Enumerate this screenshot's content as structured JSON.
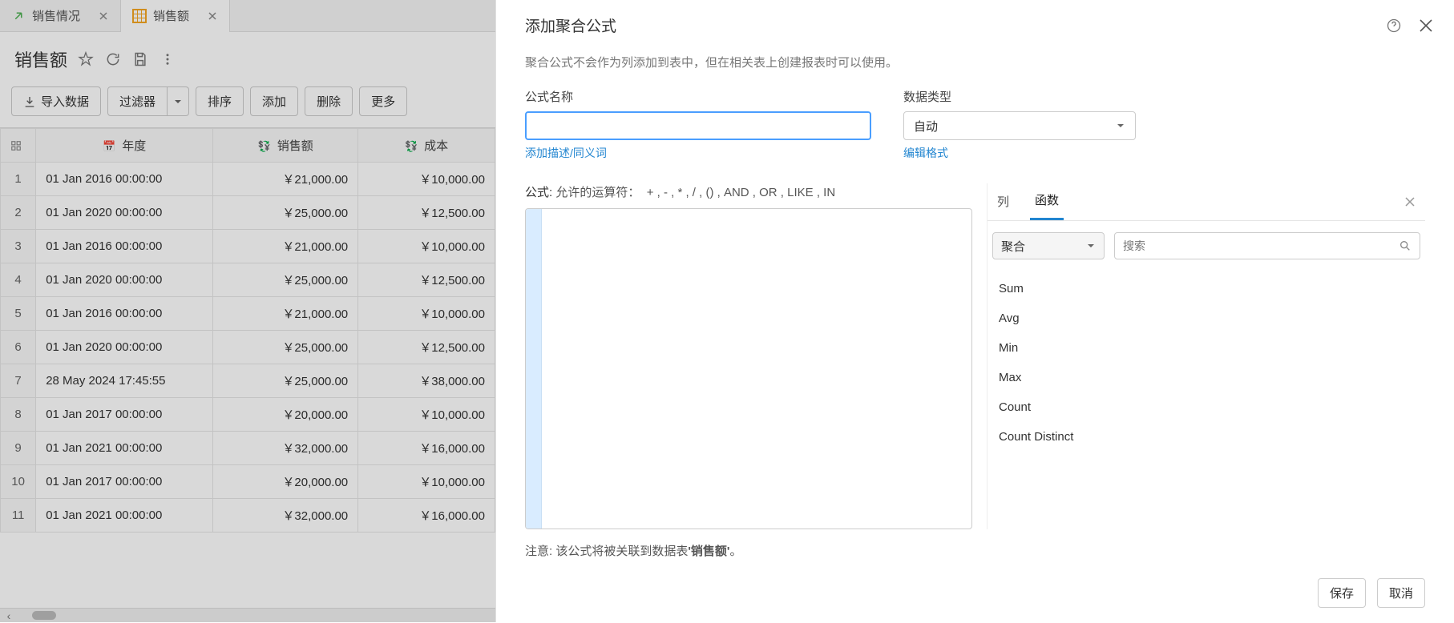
{
  "tabs": [
    {
      "label": "销售情况",
      "active": false,
      "icon": "share"
    },
    {
      "label": "销售额",
      "active": true,
      "icon": "table"
    }
  ],
  "page_title": "销售额",
  "toolbar": {
    "import": "导入数据",
    "filter": "过滤器",
    "sort": "排序",
    "add": "添加",
    "delete": "删除",
    "more": "更多"
  },
  "columns": {
    "year": "年度",
    "sales": "销售额",
    "cost": "成本"
  },
  "rows": [
    {
      "n": "1",
      "year": "01 Jan 2016 00:00:00",
      "sales": "￥21,000.00",
      "cost": "￥10,000.00"
    },
    {
      "n": "2",
      "year": "01 Jan 2020 00:00:00",
      "sales": "￥25,000.00",
      "cost": "￥12,500.00"
    },
    {
      "n": "3",
      "year": "01 Jan 2016 00:00:00",
      "sales": "￥21,000.00",
      "cost": "￥10,000.00"
    },
    {
      "n": "4",
      "year": "01 Jan 2020 00:00:00",
      "sales": "￥25,000.00",
      "cost": "￥12,500.00"
    },
    {
      "n": "5",
      "year": "01 Jan 2016 00:00:00",
      "sales": "￥21,000.00",
      "cost": "￥10,000.00"
    },
    {
      "n": "6",
      "year": "01 Jan 2020 00:00:00",
      "sales": "￥25,000.00",
      "cost": "￥12,500.00"
    },
    {
      "n": "7",
      "year": "28 May 2024 17:45:55",
      "sales": "￥25,000.00",
      "cost": "￥38,000.00"
    },
    {
      "n": "8",
      "year": "01 Jan 2017 00:00:00",
      "sales": "￥20,000.00",
      "cost": "￥10,000.00"
    },
    {
      "n": "9",
      "year": "01 Jan 2021 00:00:00",
      "sales": "￥32,000.00",
      "cost": "￥16,000.00"
    },
    {
      "n": "10",
      "year": "01 Jan 2017 00:00:00",
      "sales": "￥20,000.00",
      "cost": "￥10,000.00"
    },
    {
      "n": "11",
      "year": "01 Jan 2021 00:00:00",
      "sales": "￥32,000.00",
      "cost": "￥16,000.00"
    }
  ],
  "modal": {
    "title": "添加聚合公式",
    "description": "聚合公式不会作为列添加到表中，但在相关表上创建报表时可以使用。",
    "name_label": "公式名称",
    "name_value": "",
    "add_desc_link": "添加描述/同义词",
    "type_label": "数据类型",
    "type_value": "自动",
    "edit_format_link": "编辑格式",
    "formula_label": "公式:",
    "operators_label": "允许的运算符：",
    "operators": "+ , - , * , / , () , AND , OR , LIKE , IN",
    "tabs": {
      "columns": "列",
      "functions": "函数"
    },
    "category_value": "聚合",
    "search_placeholder": "搜索",
    "functions": [
      "Sum",
      "Avg",
      "Min",
      "Max",
      "Count",
      "Count Distinct"
    ],
    "note_prefix": "注意: 该公式将被关联到数据表",
    "note_table": "'销售额'",
    "note_suffix": "。",
    "save": "保存",
    "cancel": "取消"
  }
}
